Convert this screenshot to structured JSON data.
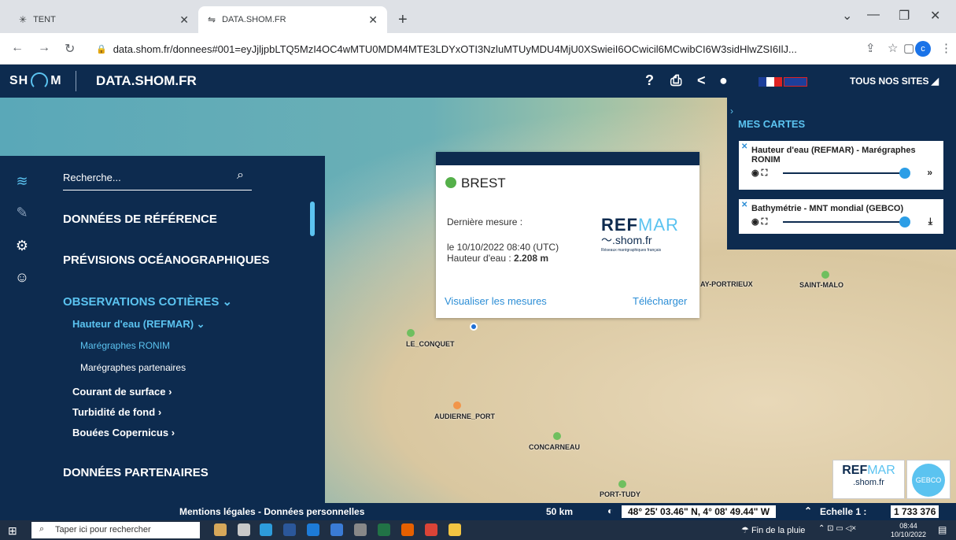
{
  "browser": {
    "tabs": [
      {
        "label": "TENT",
        "active": false
      },
      {
        "label": "DATA.SHOM.FR",
        "active": true
      }
    ],
    "url": "data.shom.fr/donnees#001=eyJjljpbLTQ5MzI4OC4wMTU0MDM4MTE3LDYxOTI3NzluMTUyMDU4MjU0XSwieiI6OCwicil6MCwibCI6W3sidHlwZSI6IlJ..."
  },
  "header": {
    "logo_text_left": "SH",
    "logo_text_right": "M",
    "title": "DATA.SHOM.FR",
    "all_sites": "TOUS NOS SITES"
  },
  "panel": {
    "search_placeholder": "Recherche...",
    "nav": {
      "reference": "DONNÉES DE RÉFÉRENCE",
      "previsions": "PRÉVISIONS OCÉANOGRAPHIQUES",
      "observations": "OBSERVATIONS COTIÈRES",
      "hauteur": "Hauteur d'eau (REFMAR)",
      "ronim": "Marégraphes RONIM",
      "partenaires_mar": "Marégraphes partenaires",
      "courant": "Courant de surface",
      "turbidite": "Turbidité de fond",
      "bouees": "Bouées Copernicus",
      "partenaires": "DONNÉES PARTENAIRES"
    }
  },
  "popup": {
    "station": "BREST",
    "last_measure_label": "Dernière mesure :",
    "date_line": "le 10/10/2022 08:40 (UTC)",
    "height_label": "Hauteur d'eau : ",
    "height_value": "2.208 m",
    "link_view": "Visualiser les mesures",
    "link_download": "Télécharger",
    "refmar_main": "REF",
    "refmar_accent": "MAR",
    "refmar_sub": ".shom.fr",
    "refmar_tiny": "Réseaux marégraphiques français"
  },
  "map": {
    "places": [
      "LE_CONQUET",
      "AUDIERNE_PORT",
      "CONCARNEAU",
      "PORT-TUDY",
      "AY-PORTRIEUX",
      "SAINT-MALO"
    ]
  },
  "cartes": {
    "title": "MES CARTES",
    "layers": [
      {
        "name": "Hauteur d'eau (REFMAR) - Marégraphes RONIM"
      },
      {
        "name": "Bathymétrie - MNT mondial (GEBCO)"
      }
    ]
  },
  "footer": {
    "mentions": "Mentions légales - Données personnelles",
    "scale": "50 km",
    "coords": "48° 25' 03.46\" N, 4° 08' 49.44\" W",
    "echelle_label": "Echelle 1 :",
    "echelle_value": "1 733 376"
  },
  "taskbar": {
    "search_placeholder": "Taper ici pour rechercher",
    "weather": "Fin de la pluie",
    "time": "08:44",
    "date": "10/10/2022"
  },
  "colors": {
    "navy": "#0d2b4f",
    "accent": "#5bc3f0",
    "station_ok": "#55b04a"
  }
}
